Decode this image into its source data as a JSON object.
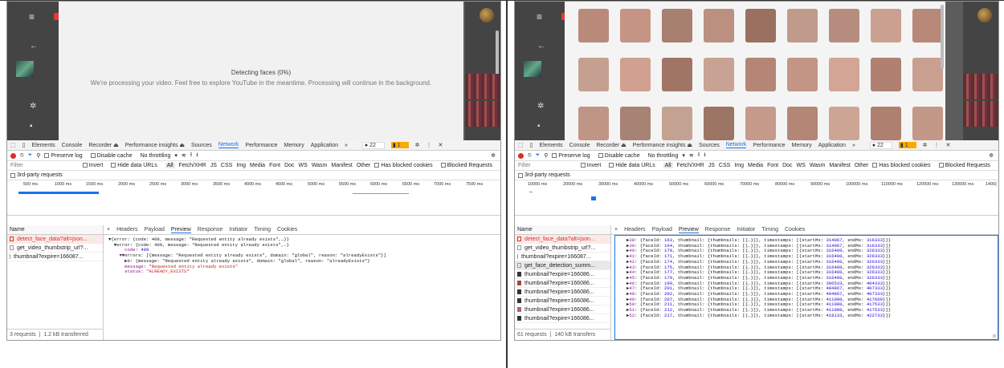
{
  "left": {
    "detecting_title": "Detecting faces (0%)",
    "detecting_message": "We're processing your video. Feel free to explore YouTube in the meantime. Processing will continue in the background.",
    "devtools": {
      "tabs": [
        "Elements",
        "Console",
        "Recorder ⏏",
        "Performance insights ⏏",
        "Sources",
        "Network",
        "Performance",
        "Memory",
        "Application",
        "»"
      ],
      "selected_tab": "Network",
      "errors": "22",
      "warnings": "1",
      "toolbar": {
        "preserve_log": "Preserve log",
        "disable_cache": "Disable cache",
        "throttling": "No throttling"
      },
      "filter_placeholder": "Filter",
      "filter_opts": [
        "Invert",
        "Hide data URLs",
        "All",
        "Fetch/XHR",
        "JS",
        "CSS",
        "Img",
        "Media",
        "Font",
        "Doc",
        "WS",
        "Wasm",
        "Manifest",
        "Other",
        "Has blocked cookies",
        "Blocked Requests"
      ],
      "third_party": "3rd-party requests",
      "ticks": [
        "500 ms",
        "1000 ms",
        "1500 ms",
        "2000 ms",
        "2500 ms",
        "3000 ms",
        "3500 ms",
        "4000 ms",
        "4500 ms",
        "5000 ms",
        "5500 ms",
        "6000 ms",
        "6500 ms",
        "7000 ms",
        "7500 ms"
      ],
      "name_header": "Name",
      "requests": [
        "detect_face_data?alt=json...",
        "get_video_thumbstrip_url?...",
        "thumbnail?expire=166087..."
      ],
      "footer_count": "3 requests",
      "footer_size": "1.2 kB transferred",
      "detail_tabs": [
        "×",
        "Headers",
        "Payload",
        "Preview",
        "Response",
        "Initiator",
        "Timing",
        "Cookies"
      ],
      "preview": {
        "l1": "▼{error: {code: 409, message: \"Requested entity already exists\",…}}",
        "l2_pre": "  ▼error: {code: 409, message: \"Requested entity already exists\",…}",
        "code_key": "code",
        "code_val": "409",
        "errors_line": "▼errors: [{message: \"Requested entity already exists\", domain: \"global\", reason: \"alreadyExists\"}]",
        "item_line": "▶0: {message: \"Requested entity already exists\", domain: \"global\", reason: \"alreadyExists\"}",
        "message_key": "message",
        "message_val": "\"Requested entity already exists\"",
        "status_key": "status",
        "status_val": "\"ALREADY_EXISTS\""
      }
    }
  },
  "right": {
    "devtools": {
      "errors": "22",
      "warnings": "1",
      "ticks": [
        "10000 ms",
        "20000 ms",
        "30000 ms",
        "40000 ms",
        "50000 ms",
        "60000 ms",
        "70000 ms",
        "80000 ms",
        "90000 ms",
        "100000 ms",
        "110000 ms",
        "120000 ms",
        "130000 ms",
        "1400("
      ],
      "requests": [
        "detect_face_data?alt=json...",
        "get_video_thumbstrip_url?...",
        "thumbnail?expire=166087...",
        "get_face_detection_summ...",
        "thumbnail?expire=166086...",
        "thumbnail?expire=166086...",
        "thumbnail?expire=166086...",
        "thumbnail?expire=166086...",
        "thumbnail?expire=166086...",
        "thumbnail?expire=166086..."
      ],
      "footer_count": "61 requests",
      "footer_size": "140 kB transfers",
      "rows": [
        {
          "idx": "38",
          "faceId": "163",
          "s": "314067",
          "e": "316333"
        },
        {
          "idx": "39",
          "faceId": "164",
          "s": "314067",
          "e": "316333"
        },
        {
          "idx": "40",
          "faceId": "170",
          "s": "316400",
          "e": "326333"
        },
        {
          "idx": "41",
          "faceId": "171",
          "s": "316400",
          "e": "326333"
        },
        {
          "idx": "42",
          "faceId": "174",
          "s": "316400",
          "e": "326333"
        },
        {
          "idx": "43",
          "faceId": "175",
          "s": "316400",
          "e": "326333"
        },
        {
          "idx": "44",
          "faceId": "177",
          "s": "316400",
          "e": "326333"
        },
        {
          "idx": "45",
          "faceId": "179",
          "s": "316400",
          "e": "326333"
        },
        {
          "idx": "46",
          "faceId": "199",
          "s": "396533",
          "e": "404333"
        },
        {
          "idx": "47",
          "faceId": "201",
          "s": "404867",
          "e": "407333"
        },
        {
          "idx": "48",
          "faceId": "202",
          "s": "404867",
          "e": "407333"
        },
        {
          "idx": "49",
          "faceId": "207",
          "s": "411000",
          "e": "417600"
        },
        {
          "idx": "50",
          "faceId": "211",
          "s": "411000",
          "e": "417533"
        },
        {
          "idx": "51",
          "faceId": "212",
          "s": "411000",
          "e": "417533"
        },
        {
          "idx": "52",
          "faceId": "217",
          "s": "418133",
          "e": "422733"
        }
      ]
    }
  }
}
